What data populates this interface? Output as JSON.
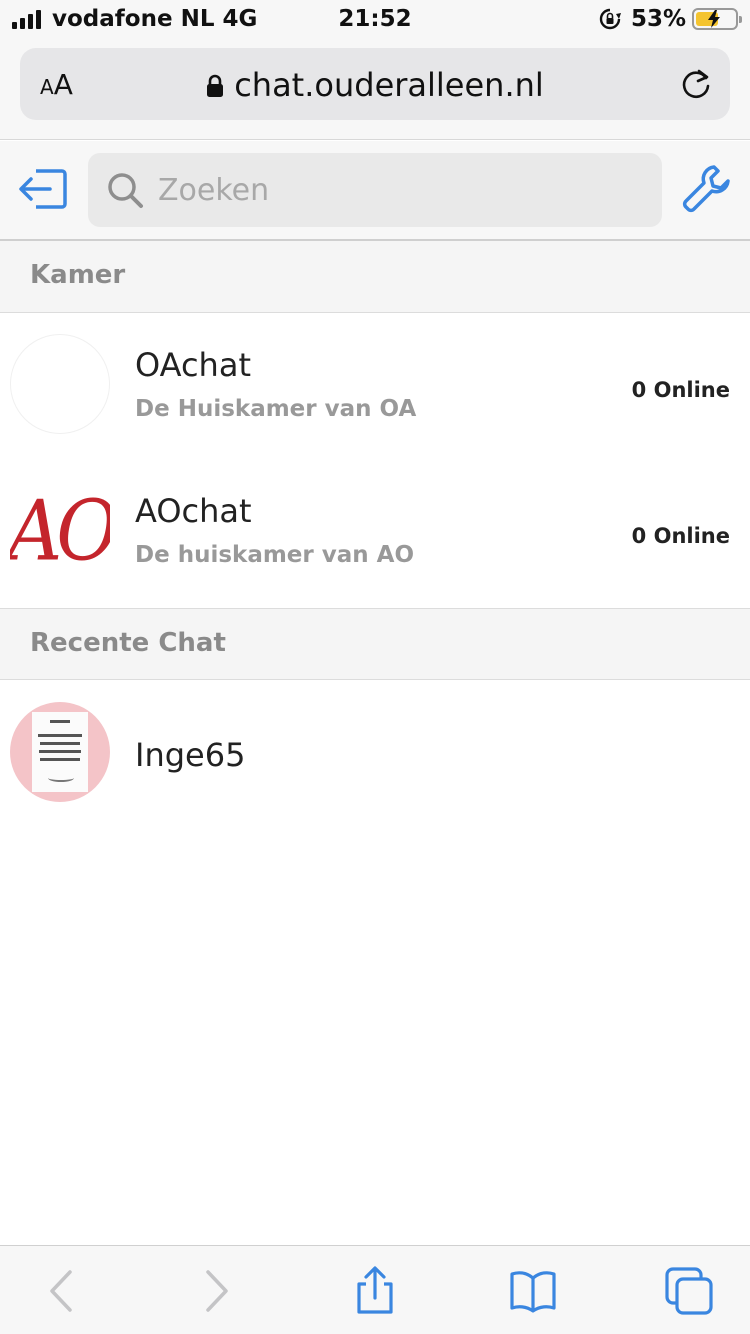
{
  "status_bar": {
    "carrier": "vodafone NL",
    "network": "4G",
    "time": "21:52",
    "battery": "53%",
    "battery_level": 0.53,
    "icons": [
      "signal-icon",
      "rotation-lock-icon",
      "battery-charging-icon"
    ]
  },
  "browser": {
    "text_size_label_small": "A",
    "text_size_label_large": "A",
    "url": "chat.ouderalleen.nl",
    "icons": [
      "lock-icon",
      "reload-icon"
    ]
  },
  "app_header": {
    "search_placeholder": "Zoeken",
    "icons": [
      "logout-icon",
      "search-icon",
      "wrench-icon"
    ],
    "accent_color": "#3a86e0"
  },
  "sections": {
    "rooms_title": "Kamer",
    "recent_title": "Recente Chat"
  },
  "rooms": [
    {
      "name": "OAchat",
      "subtitle": "De Huiskamer van OA",
      "online": "0 Online"
    },
    {
      "name": "AOchat",
      "subtitle": "De huiskamer van AO",
      "online": "0 Online",
      "avatar_text": "AO",
      "avatar_color": "#c4252c"
    }
  ],
  "recent_chats": [
    {
      "name": "Inge65"
    }
  ],
  "toolbar": {
    "icons": [
      "back-icon",
      "forward-icon",
      "share-icon",
      "bookmarks-icon",
      "tabs-icon"
    ],
    "accent_color": "#3a86e0"
  }
}
